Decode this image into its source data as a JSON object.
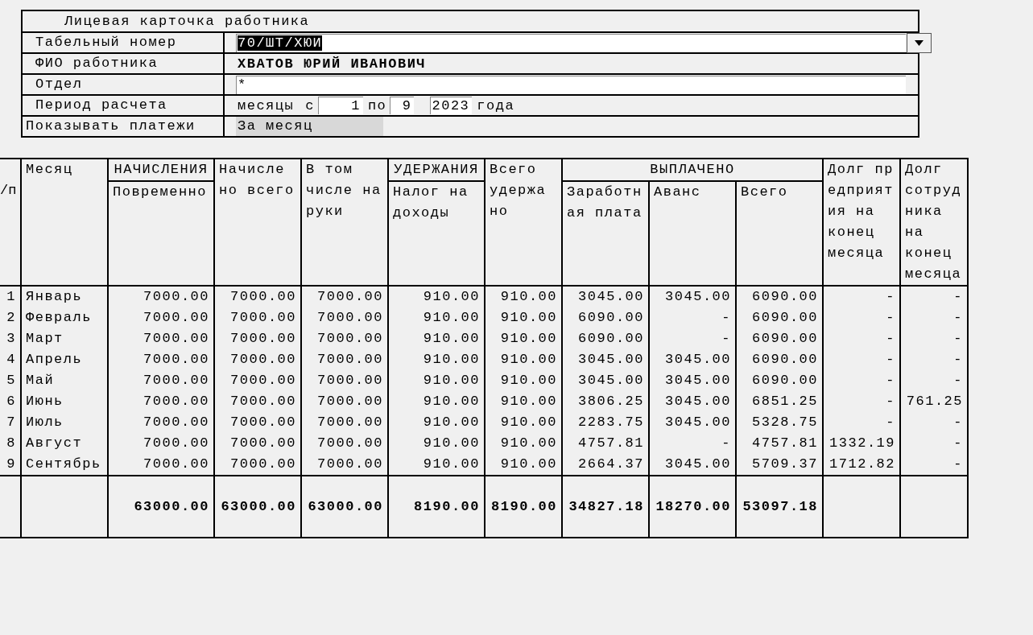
{
  "form": {
    "title": "Лицевая карточка работника",
    "rows": [
      {
        "kind": "combo",
        "label": "Табельный номер",
        "value": "70/ШТ/ХЮИ",
        "text_selected": true
      },
      {
        "kind": "bold",
        "label": "ФИО работника",
        "value": "ХВАТОВ ЮРИЙ ИВАНОВИЧ"
      },
      {
        "kind": "input",
        "label": "Отдел",
        "value": "*"
      },
      {
        "kind": "period",
        "label": "Период расчета",
        "unit": "месяцы",
        "from_label": "с",
        "from": "1",
        "to_label": "по",
        "to": "9",
        "year": "2023",
        "year_label": "года"
      },
      {
        "kind": "select",
        "label": "Показывать платежи",
        "value": "За месяц"
      }
    ]
  },
  "table": {
    "header": [
      {
        "label": "/п"
      },
      {
        "label": "Месяц"
      },
      {
        "group": "НАЧИСЛЕНИЯ",
        "children": [
          {
            "label": "Повременно"
          }
        ]
      },
      {
        "label": "Начисле\nно всего"
      },
      {
        "label": "В том\nчисле на\nруки"
      },
      {
        "group": "УДЕРЖАНИЯ",
        "children": [
          {
            "label": "Налог на\nдоходы"
          }
        ]
      },
      {
        "label": "Всего\nудержа\nно"
      },
      {
        "group": "ВЫПЛАЧЕНО",
        "children": [
          {
            "label": "Заработн\nая плата"
          },
          {
            "label": "Аванс"
          },
          {
            "label": "Всего"
          }
        ]
      },
      {
        "label": "Долг пр\nедприят\nия на\nконец\nмесяца"
      },
      {
        "label": "Долг\nсотруд\nника\nна\nконец\nмесяца"
      }
    ],
    "rows": [
      {
        "n": "1",
        "month": "Январь",
        "values": [
          "7000.00",
          "7000.00",
          "7000.00",
          "910.00",
          "910.00",
          "3045.00",
          "3045.00",
          "6090.00",
          "-",
          "-"
        ]
      },
      {
        "n": "2",
        "month": "Февраль",
        "values": [
          "7000.00",
          "7000.00",
          "7000.00",
          "910.00",
          "910.00",
          "6090.00",
          "-",
          "6090.00",
          "-",
          "-"
        ]
      },
      {
        "n": "3",
        "month": "Март",
        "values": [
          "7000.00",
          "7000.00",
          "7000.00",
          "910.00",
          "910.00",
          "6090.00",
          "-",
          "6090.00",
          "-",
          "-"
        ]
      },
      {
        "n": "4",
        "month": "Апрель",
        "values": [
          "7000.00",
          "7000.00",
          "7000.00",
          "910.00",
          "910.00",
          "3045.00",
          "3045.00",
          "6090.00",
          "-",
          "-"
        ]
      },
      {
        "n": "5",
        "month": "Май",
        "values": [
          "7000.00",
          "7000.00",
          "7000.00",
          "910.00",
          "910.00",
          "3045.00",
          "3045.00",
          "6090.00",
          "-",
          "-"
        ]
      },
      {
        "n": "6",
        "month": "Июнь",
        "values": [
          "7000.00",
          "7000.00",
          "7000.00",
          "910.00",
          "910.00",
          "3806.25",
          "3045.00",
          "6851.25",
          "-",
          "761.25"
        ]
      },
      {
        "n": "7",
        "month": "Июль",
        "values": [
          "7000.00",
          "7000.00",
          "7000.00",
          "910.00",
          "910.00",
          "2283.75",
          "3045.00",
          "5328.75",
          "-",
          "-"
        ]
      },
      {
        "n": "8",
        "month": "Август",
        "values": [
          "7000.00",
          "7000.00",
          "7000.00",
          "910.00",
          "910.00",
          "4757.81",
          "-",
          "4757.81",
          "1332.19",
          "-"
        ]
      },
      {
        "n": "9",
        "month": "Сентябрь",
        "values": [
          "7000.00",
          "7000.00",
          "7000.00",
          "910.00",
          "910.00",
          "2664.37",
          "3045.00",
          "5709.37",
          "1712.82",
          "-"
        ]
      }
    ],
    "totals": [
      "63000.00",
      "63000.00",
      "63000.00",
      "8190.00",
      "8190.00",
      "34827.18",
      "18270.00",
      "53097.18"
    ]
  }
}
